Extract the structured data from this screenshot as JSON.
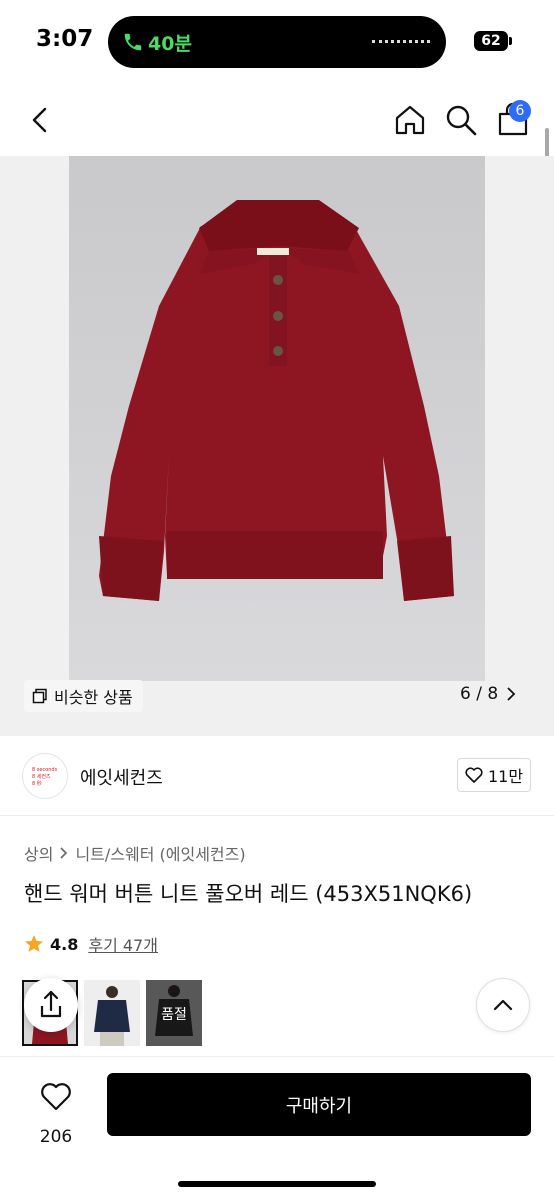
{
  "status_bar": {
    "time": "3:07",
    "call_duration": "40분",
    "battery": "62",
    "call_icon": "phone-icon"
  },
  "nav": {
    "back_icon": "chevron-left-icon",
    "home_icon": "home-icon",
    "search_icon": "search-icon",
    "cart_icon": "shopping-bag-icon",
    "cart_count": "6"
  },
  "gallery": {
    "similar_label": "비슷한 상품",
    "page_indicator": "6 / 8",
    "colors": {
      "sweater": "#8e1623",
      "background": "#c7c7c9"
    }
  },
  "brand": {
    "name": "에잇세컨즈",
    "logo_lines": [
      "8 seconds",
      "8 세컨즈",
      "8 秒"
    ],
    "likes": "11만"
  },
  "product": {
    "breadcrumb": [
      "상의",
      "니트/스웨터 (에잇세컨즈)"
    ],
    "title": "핸드 워머 버튼 니트 풀오버 레드 (453X51NQK6)",
    "rating": "4.8",
    "reviews": "후기 47개"
  },
  "thumbnails": [
    {
      "label": ""
    },
    {
      "label": ""
    },
    {
      "label": "품절"
    }
  ],
  "bottom_bar": {
    "wish_count": "206",
    "buy_label": "구매하기"
  }
}
